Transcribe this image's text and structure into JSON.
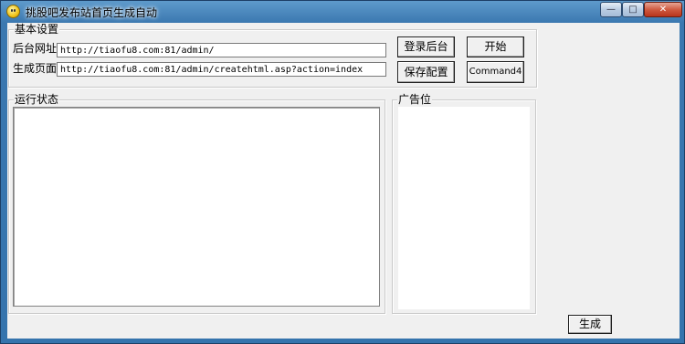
{
  "window": {
    "title": "挑股吧发布站首页生成自动",
    "icon": "smiley-icon",
    "controls": {
      "minimize": "—",
      "maximize": "□",
      "close": "✕"
    }
  },
  "basic_settings": {
    "legend": "基本设置",
    "backend_label": "后台网址:",
    "backend_value": "http://tiaofu8.com:81/admin/",
    "generate_label": "生成页面:",
    "generate_value": "http://tiaofu8.com:81/admin/createhtml.asp?action=index"
  },
  "buttons": {
    "login": "登录后台",
    "start": "开始",
    "save": "保存配置",
    "command4": "Command4",
    "generate": "生成"
  },
  "status": {
    "legend": "运行状态",
    "value": ""
  },
  "ad": {
    "legend": "广告位"
  }
}
